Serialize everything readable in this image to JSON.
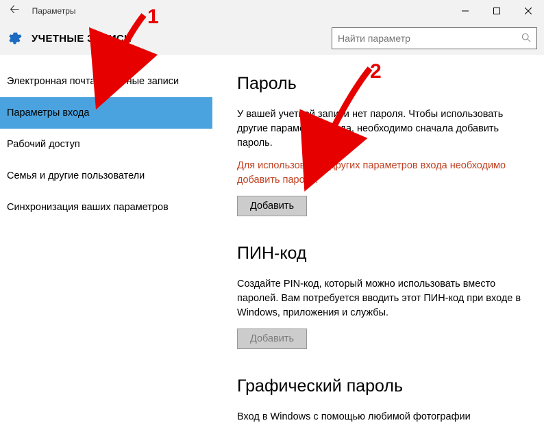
{
  "window": {
    "title": "Параметры"
  },
  "header": {
    "title": "УЧЕТНЫЕ ЗАПИСИ"
  },
  "search": {
    "placeholder": "Найти параметр"
  },
  "sidebar": {
    "items": [
      "Электронная почта и учетные записи",
      "Параметры входа",
      "Рабочий доступ",
      "Семья и другие пользователи",
      "Синхронизация ваших параметров"
    ]
  },
  "sections": {
    "password": {
      "title": "Пароль",
      "text": "У вашей учетной записи нет пароля. Чтобы использовать другие параметры входа, необходимо сначала добавить пароль.",
      "warn": "Для использования других параметров входа необходимо добавить пароль.",
      "button": "Добавить"
    },
    "pin": {
      "title": "ПИН-код",
      "text": "Создайте PIN-код, который можно использовать вместо паролей. Вам потребуется вводить этот ПИН-код при входе в Windows, приложения и службы.",
      "button": "Добавить"
    },
    "picture": {
      "title": "Графический пароль",
      "text": "Вход в Windows с помощью любимой фотографии"
    }
  },
  "annotations": {
    "step1": "1",
    "step2": "2"
  }
}
